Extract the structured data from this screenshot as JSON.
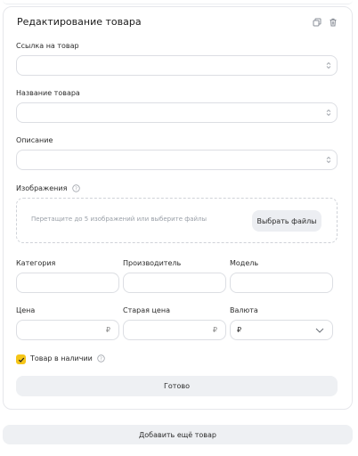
{
  "card": {
    "title": "Редактирование товара",
    "copy_icon": "copy-icon",
    "delete_icon": "trash-icon"
  },
  "fields": {
    "link_label": "Ссылка на товар",
    "name_label": "Название товара",
    "description_label": "Описание",
    "images_label": "Изображения",
    "dropzone_text": "Перетащите до 5 изображений или выберите файлы",
    "choose_files": "Выбрать файлы",
    "category_label": "Категория",
    "manufacturer_label": "Производитель",
    "model_label": "Модель",
    "price_label": "Цена",
    "old_price_label": "Старая цена",
    "currency_label": "Валюта",
    "currency_symbol": "₽",
    "currency_value": "₽"
  },
  "stock": {
    "label": "Товар в наличии",
    "checked": true
  },
  "actions": {
    "done": "Готово",
    "add_more": "Добавить ещё товар"
  },
  "colors": {
    "accent": "#f5c518",
    "button_bg": "#eef0f3",
    "border": "#dcdee3"
  }
}
